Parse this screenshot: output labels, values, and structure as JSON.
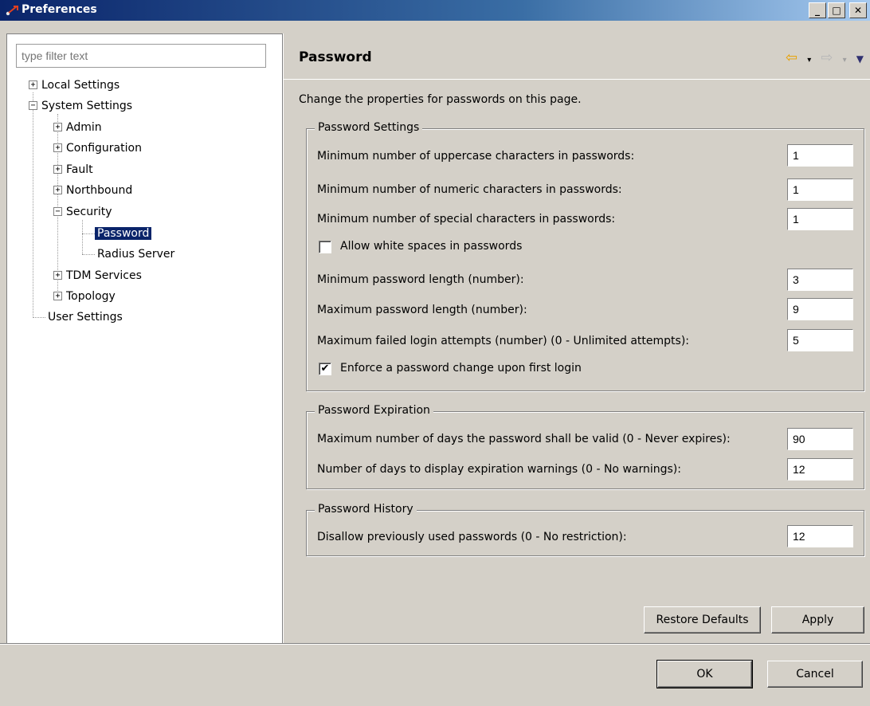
{
  "window": {
    "title": "Preferences",
    "minimize": "_",
    "maximize": "□",
    "close": "✕"
  },
  "sidebar": {
    "filter_placeholder": "type filter text",
    "items": [
      {
        "label": "Local Settings",
        "expander": "+"
      },
      {
        "label": "System Settings",
        "expander": "−"
      },
      {
        "label": "Admin",
        "expander": "+"
      },
      {
        "label": "Configuration",
        "expander": "+"
      },
      {
        "label": "Fault",
        "expander": "+"
      },
      {
        "label": "Northbound",
        "expander": "+"
      },
      {
        "label": "Security",
        "expander": "−"
      },
      {
        "label": "Password"
      },
      {
        "label": "Radius Server"
      },
      {
        "label": "TDM Services",
        "expander": "+"
      },
      {
        "label": "Topology",
        "expander": "+"
      },
      {
        "label": "User Settings"
      }
    ]
  },
  "page": {
    "title": "Password",
    "description": "Change the properties for passwords on this page.",
    "nav": {
      "back": "⇦",
      "back_menu": "▾",
      "forward": "⇨",
      "forward_menu": "▾",
      "view_menu": "▼"
    }
  },
  "settings": {
    "label": "Password Settings",
    "uppercase_label": "Minimum number of uppercase characters in passwords:",
    "uppercase_value": "1",
    "numeric_label": "Minimum number of numeric characters in passwords:",
    "numeric_value": "1",
    "special_label": "Minimum number of special characters in passwords:",
    "special_value": "1",
    "whitespace_label": "Allow white spaces in passwords",
    "whitespace_checked": "",
    "min_length_label": "Minimum password length (number):",
    "min_length_value": "3",
    "max_length_label": "Maximum password length (number):",
    "max_length_value": "9",
    "failed_label": "Maximum failed login attempts (number) (0 - Unlimited attempts):",
    "failed_value": "5",
    "enforce_label": "Enforce a password change upon first login",
    "enforce_checked": "✔"
  },
  "expiration": {
    "label": "Password Expiration",
    "days_valid_label": "Maximum number of days the password shall be valid (0 - Never expires):",
    "days_valid_value": "90",
    "warning_label": "Number of days to display expiration warnings (0 - No warnings):",
    "warning_value": "12"
  },
  "history": {
    "label": "Password History",
    "disallow_label": "Disallow previously used passwords (0 - No restriction):",
    "disallow_value": "12"
  },
  "buttons": {
    "restore": "Restore Defaults",
    "apply": "Apply",
    "ok": "OK",
    "cancel": "Cancel"
  }
}
